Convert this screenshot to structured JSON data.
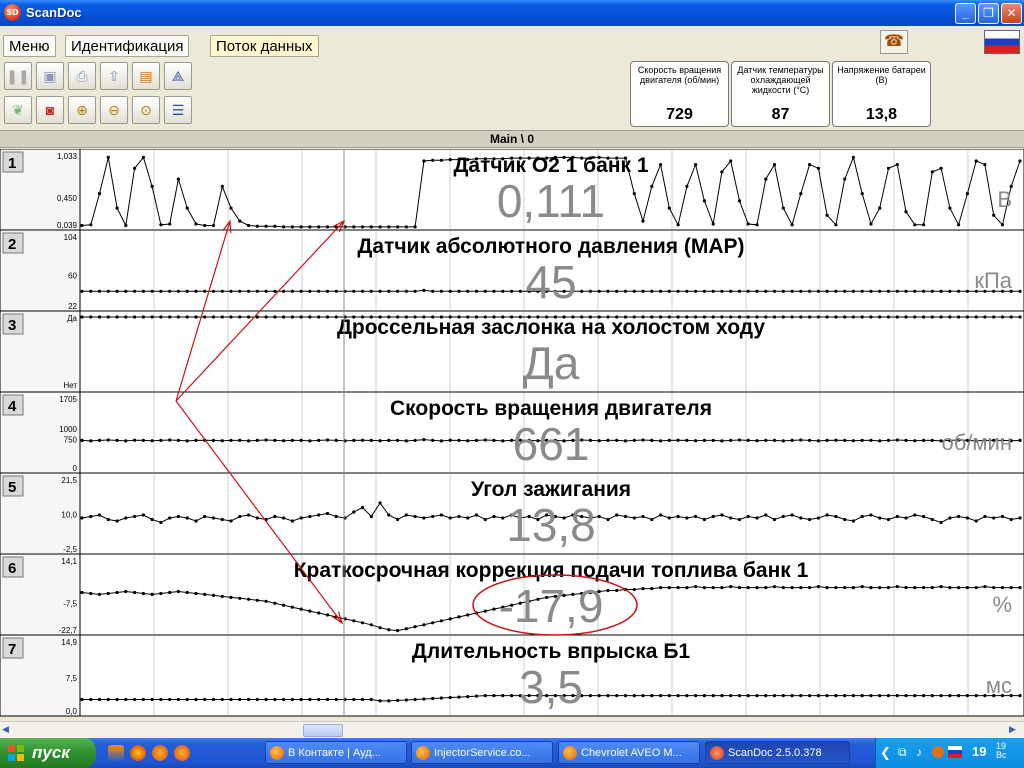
{
  "window": {
    "title": "ScanDoc",
    "icon_label": "SD",
    "minimize": "_",
    "maximize": "❐",
    "close": "✕"
  },
  "tabs": [
    {
      "label": "Меню"
    },
    {
      "label": "Идентификация"
    },
    {
      "label": "Поток данных"
    }
  ],
  "sensors": [
    {
      "label": "Скорость вращения двигателя  (об/мин)",
      "value": "729"
    },
    {
      "label": "Датчик температуры охлаждающей жидкости  (°C)",
      "value": "87"
    },
    {
      "label": "Напряжение батареи (В)",
      "value": "13,8"
    }
  ],
  "main_label": "Main \\ 0",
  "icons": {
    "pause": "pause-icon",
    "save": "save-icon",
    "print": "print-icon",
    "export": "export-icon",
    "folder": "folder-icon",
    "tree": "tree-icon",
    "leaf": "leaf-icon",
    "record": "record-icon",
    "zoom_in": "zoom-in-icon",
    "zoom_out": "zoom-out-icon",
    "zoom_fit": "zoom-fit-icon",
    "list": "list-icon",
    "phone": "phone-icon",
    "flag": "russia-flag-icon"
  },
  "chart_data": [
    {
      "type": "line",
      "panel": "1",
      "title": "Датчик О2 1 банк 1",
      "value": "0,111",
      "unit": "В",
      "yticks": [
        "1,033",
        "0,450",
        "0,039"
      ],
      "ylim": [
        0.039,
        1.033
      ],
      "values": [
        0.06,
        0.07,
        0.5,
        1.0,
        0.3,
        0.06,
        0.85,
        1.0,
        0.6,
        0.07,
        0.08,
        0.7,
        0.3,
        0.08,
        0.06,
        0.06,
        0.6,
        0.3,
        0.12,
        0.06,
        0.05,
        0.05,
        0.05,
        0.04,
        0.04,
        0.04,
        0.04,
        0.04,
        0.04,
        0.04,
        0.04,
        0.04,
        0.04,
        0.04,
        0.04,
        0.04,
        0.04,
        0.04,
        0.04,
        0.95,
        0.96,
        0.96,
        0.97,
        0.97,
        0.97,
        0.98,
        0.98,
        0.98,
        0.98,
        0.99,
        0.99,
        0.99,
        0.99,
        0.99,
        1.0,
        1.0,
        1.0,
        0.99,
        0.99,
        1.0,
        0.99,
        0.99,
        0.99,
        0.5,
        0.12,
        0.6,
        0.9,
        0.3,
        0.07,
        0.6,
        0.9,
        0.4,
        0.08,
        0.8,
        0.95,
        0.4,
        0.08,
        0.07,
        0.7,
        0.9,
        0.3,
        0.07,
        0.5,
        0.9,
        0.85,
        0.2,
        0.07,
        0.7,
        1.0,
        0.5,
        0.08,
        0.3,
        0.85,
        0.9,
        0.25,
        0.07,
        0.07,
        0.8,
        0.85,
        0.3,
        0.07,
        0.5,
        0.95,
        0.9,
        0.2,
        0.07,
        0.6,
        0.95
      ]
    },
    {
      "type": "line",
      "panel": "2",
      "title": "Датчик абсолютного давления (MAP)",
      "value": "45",
      "unit": "кПа",
      "yticks": [
        "104",
        "60",
        "22"
      ],
      "ylim": [
        22,
        104
      ],
      "values": [
        41,
        41,
        41,
        41,
        41,
        41,
        41,
        41,
        41,
        41,
        41,
        41,
        41,
        41,
        41,
        41,
        41,
        41,
        41,
        41,
        41,
        41,
        41,
        41,
        41,
        41,
        41,
        41,
        41,
        41,
        41,
        41,
        41,
        41,
        41,
        41,
        41,
        41,
        41,
        42,
        41,
        41,
        41,
        41,
        41,
        41,
        41,
        41,
        41,
        41,
        41,
        41,
        41,
        41,
        41,
        41,
        41,
        41,
        41,
        41,
        41,
        41,
        41,
        41,
        41,
        41,
        41,
        41,
        41,
        41,
        41,
        41,
        41,
        41,
        41,
        41,
        41,
        41,
        41,
        41,
        41,
        41,
        41,
        41,
        41,
        41,
        41,
        41,
        41,
        41,
        41,
        41,
        41,
        41,
        41,
        41,
        41,
        41,
        41,
        41,
        41,
        41,
        41,
        41,
        41,
        41,
        41,
        41
      ]
    },
    {
      "type": "line",
      "panel": "3",
      "title": "Дроссельная заслонка на холостом ходу",
      "value": "Да",
      "unit": "",
      "yticks": [
        "Да",
        "Нет"
      ],
      "ylim": [
        0,
        1
      ],
      "values": [
        1,
        1,
        1,
        1,
        1,
        1,
        1,
        1,
        1,
        1,
        1,
        1,
        1,
        1,
        1,
        1,
        1,
        1,
        1,
        1,
        1,
        1,
        1,
        1,
        1,
        1,
        1,
        1,
        1,
        1,
        1,
        1,
        1,
        1,
        1,
        1,
        1,
        1,
        1,
        1,
        1,
        1,
        1,
        1,
        1,
        1,
        1,
        1,
        1,
        1,
        1,
        1,
        1,
        1,
        1,
        1,
        1,
        1,
        1,
        1,
        1,
        1,
        1,
        1,
        1,
        1,
        1,
        1,
        1,
        1,
        1,
        1,
        1,
        1,
        1,
        1,
        1,
        1,
        1,
        1,
        1,
        1,
        1,
        1,
        1,
        1,
        1,
        1,
        1,
        1,
        1,
        1,
        1,
        1,
        1,
        1,
        1,
        1,
        1,
        1,
        1,
        1,
        1,
        1,
        1,
        1,
        1,
        1
      ]
    },
    {
      "type": "line",
      "panel": "4",
      "title": "Скорость вращения двигателя",
      "value": "661",
      "unit": "об/мин",
      "yticks": [
        "1705",
        "1000",
        "750",
        "0"
      ],
      "ylim": [
        0,
        1705
      ],
      "values": [
        700,
        690,
        700,
        710,
        700,
        690,
        705,
        700,
        695,
        700,
        710,
        700,
        690,
        700,
        705,
        700,
        695,
        700,
        700,
        690,
        700,
        710,
        700,
        695,
        700,
        700,
        690,
        700,
        710,
        700,
        690,
        700,
        705,
        700,
        695,
        700,
        700,
        690,
        700,
        720,
        700,
        690,
        705,
        700,
        695,
        700,
        710,
        700,
        690,
        700,
        705,
        700,
        695,
        700,
        700,
        690,
        700,
        710,
        700,
        695,
        700,
        700,
        690,
        700,
        710,
        700,
        690,
        700,
        705,
        700,
        695,
        700,
        700,
        690,
        700,
        710,
        700,
        695,
        700,
        700,
        690,
        700,
        710,
        700,
        690,
        700,
        705,
        700,
        695,
        700,
        700,
        690,
        700,
        710,
        700,
        695,
        700,
        700,
        690,
        700,
        710,
        700,
        690,
        700,
        705,
        700,
        695,
        700
      ]
    },
    {
      "type": "line",
      "panel": "5",
      "title": "Угол зажигания",
      "value": "13,8",
      "unit": "",
      "yticks": [
        "21,5",
        "10,0",
        "-2,5"
      ],
      "ylim": [
        -2.5,
        21.5
      ],
      "values": [
        8.5,
        9.0,
        9.5,
        8.0,
        7.5,
        8.5,
        9.0,
        9.5,
        8.0,
        7.0,
        8.5,
        9.0,
        8.5,
        7.5,
        9.0,
        8.5,
        8.0,
        7.5,
        9.0,
        9.5,
        8.5,
        8.0,
        9.0,
        8.5,
        7.5,
        8.5,
        9.0,
        9.5,
        10.0,
        9.0,
        8.5,
        10.5,
        12.0,
        9.0,
        13.5,
        9.5,
        8.0,
        9.5,
        9.0,
        8.5,
        9.0,
        9.5,
        8.5,
        9.0,
        8.5,
        9.5,
        8.0,
        9.0,
        8.5,
        9.5,
        8.5,
        9.0,
        8.0,
        9.5,
        9.0,
        8.5,
        9.5,
        9.0,
        8.5,
        9.0,
        8.0,
        9.5,
        9.0,
        8.5,
        9.0,
        8.0,
        9.5,
        8.5,
        9.0,
        8.5,
        9.0,
        8.0,
        9.0,
        9.5,
        8.5,
        8.0,
        9.0,
        8.5,
        9.5,
        8.0,
        9.0,
        9.5,
        8.5,
        8.0,
        8.5,
        9.5,
        9.0,
        8.0,
        7.5,
        9.0,
        9.5,
        8.5,
        8.0,
        9.0,
        8.5,
        9.5,
        9.0,
        8.0,
        7.0,
        8.5,
        9.0,
        8.5,
        7.5,
        9.0,
        8.5,
        9.0,
        8.0,
        8.5
      ]
    },
    {
      "type": "line",
      "panel": "6",
      "title": "Краткосрочная коррекция подачи топлива банк 1",
      "value": "-17,9",
      "unit": "%",
      "yticks": [
        "14,1",
        "-7,5",
        "-22,7"
      ],
      "ylim": [
        -22.7,
        14.1
      ],
      "values": [
        -2.5,
        -3.0,
        -3.5,
        -3.0,
        -2.5,
        -2.0,
        -2.5,
        -3.0,
        -3.5,
        -3.0,
        -2.5,
        -2.0,
        -2.5,
        -3.0,
        -3.5,
        -4.0,
        -4.5,
        -5.0,
        -5.5,
        -6.0,
        -6.5,
        -7.0,
        -8.0,
        -9.0,
        -10.0,
        -11.0,
        -12.0,
        -13.0,
        -14.0,
        -15.0,
        -16.0,
        -17.0,
        -18.0,
        -19.0,
        -20.5,
        -21.5,
        -22.0,
        -21.0,
        -20.0,
        -19.0,
        -18.0,
        -17.0,
        -16.0,
        -15.0,
        -14.0,
        -13.0,
        -12.0,
        -11.0,
        -10.0,
        -9.0,
        -8.0,
        -7.0,
        -6.0,
        -5.0,
        -4.5,
        -4.0,
        -3.5,
        -3.0,
        -2.5,
        -2.0,
        -1.5,
        -1.5,
        -1.0,
        -1.0,
        -0.5,
        -0.5,
        0.0,
        0.0,
        0.0,
        0.0,
        0.5,
        0.0,
        0.0,
        0.0,
        0.5,
        0.0,
        0.0,
        0.0,
        0.0,
        0.5,
        0.0,
        0.0,
        0.0,
        0.0,
        0.5,
        0.0,
        0.0,
        0.0,
        0.0,
        0.5,
        0.0,
        0.0,
        0.0,
        0.5,
        0.0,
        0.0,
        0.0,
        0.0,
        0.5,
        0.0,
        0.0,
        0.0,
        0.0,
        0.5,
        0.0,
        0.0,
        0.0,
        0.0
      ]
    },
    {
      "type": "line",
      "panel": "7",
      "title": "Длительность впрыска Б1",
      "value": "3,5",
      "unit": "мс",
      "yticks": [
        "14,9",
        "7,5",
        "0,0"
      ],
      "ylim": [
        0,
        14.9
      ],
      "values": [
        2.8,
        2.8,
        2.8,
        2.8,
        2.8,
        2.8,
        2.8,
        2.8,
        2.8,
        2.8,
        2.8,
        2.8,
        2.8,
        2.8,
        2.8,
        2.8,
        2.8,
        2.8,
        2.8,
        2.8,
        2.8,
        2.8,
        2.8,
        2.8,
        2.8,
        2.8,
        2.8,
        2.8,
        2.8,
        2.8,
        2.8,
        2.8,
        2.8,
        2.8,
        2.5,
        2.5,
        2.6,
        2.7,
        2.8,
        2.9,
        3.0,
        3.1,
        3.2,
        3.3,
        3.4,
        3.5,
        3.6,
        3.6,
        3.6,
        3.6,
        3.6,
        3.6,
        3.6,
        3.6,
        3.6,
        3.6,
        3.6,
        3.6,
        3.6,
        3.6,
        3.6,
        3.6,
        3.6,
        3.6,
        3.6,
        3.6,
        3.6,
        3.6,
        3.6,
        3.6,
        3.6,
        3.6,
        3.6,
        3.6,
        3.6,
        3.6,
        3.6,
        3.6,
        3.6,
        3.6,
        3.6,
        3.6,
        3.6,
        3.6,
        3.6,
        3.6,
        3.6,
        3.6,
        3.6,
        3.6,
        3.6,
        3.6,
        3.6,
        3.6,
        3.6,
        3.6,
        3.6,
        3.6,
        3.6,
        3.6,
        3.6,
        3.6,
        3.6,
        3.6,
        3.6,
        3.6,
        3.6,
        3.6
      ]
    }
  ],
  "taskbar": {
    "start": "пуск",
    "tasks": [
      {
        "label": "В Контакте | Ауд..."
      },
      {
        "label": "InjectorService.co..."
      },
      {
        "label": "Chevrolet AVEO M..."
      },
      {
        "label": "ScanDoc 2.5.0.378"
      }
    ],
    "clock": "19",
    "clock_sup": "19",
    "day": "Вс"
  },
  "colors": {
    "annotation": "#CC1111",
    "value_text": "#8A8A8A",
    "title_text": "#000000"
  }
}
